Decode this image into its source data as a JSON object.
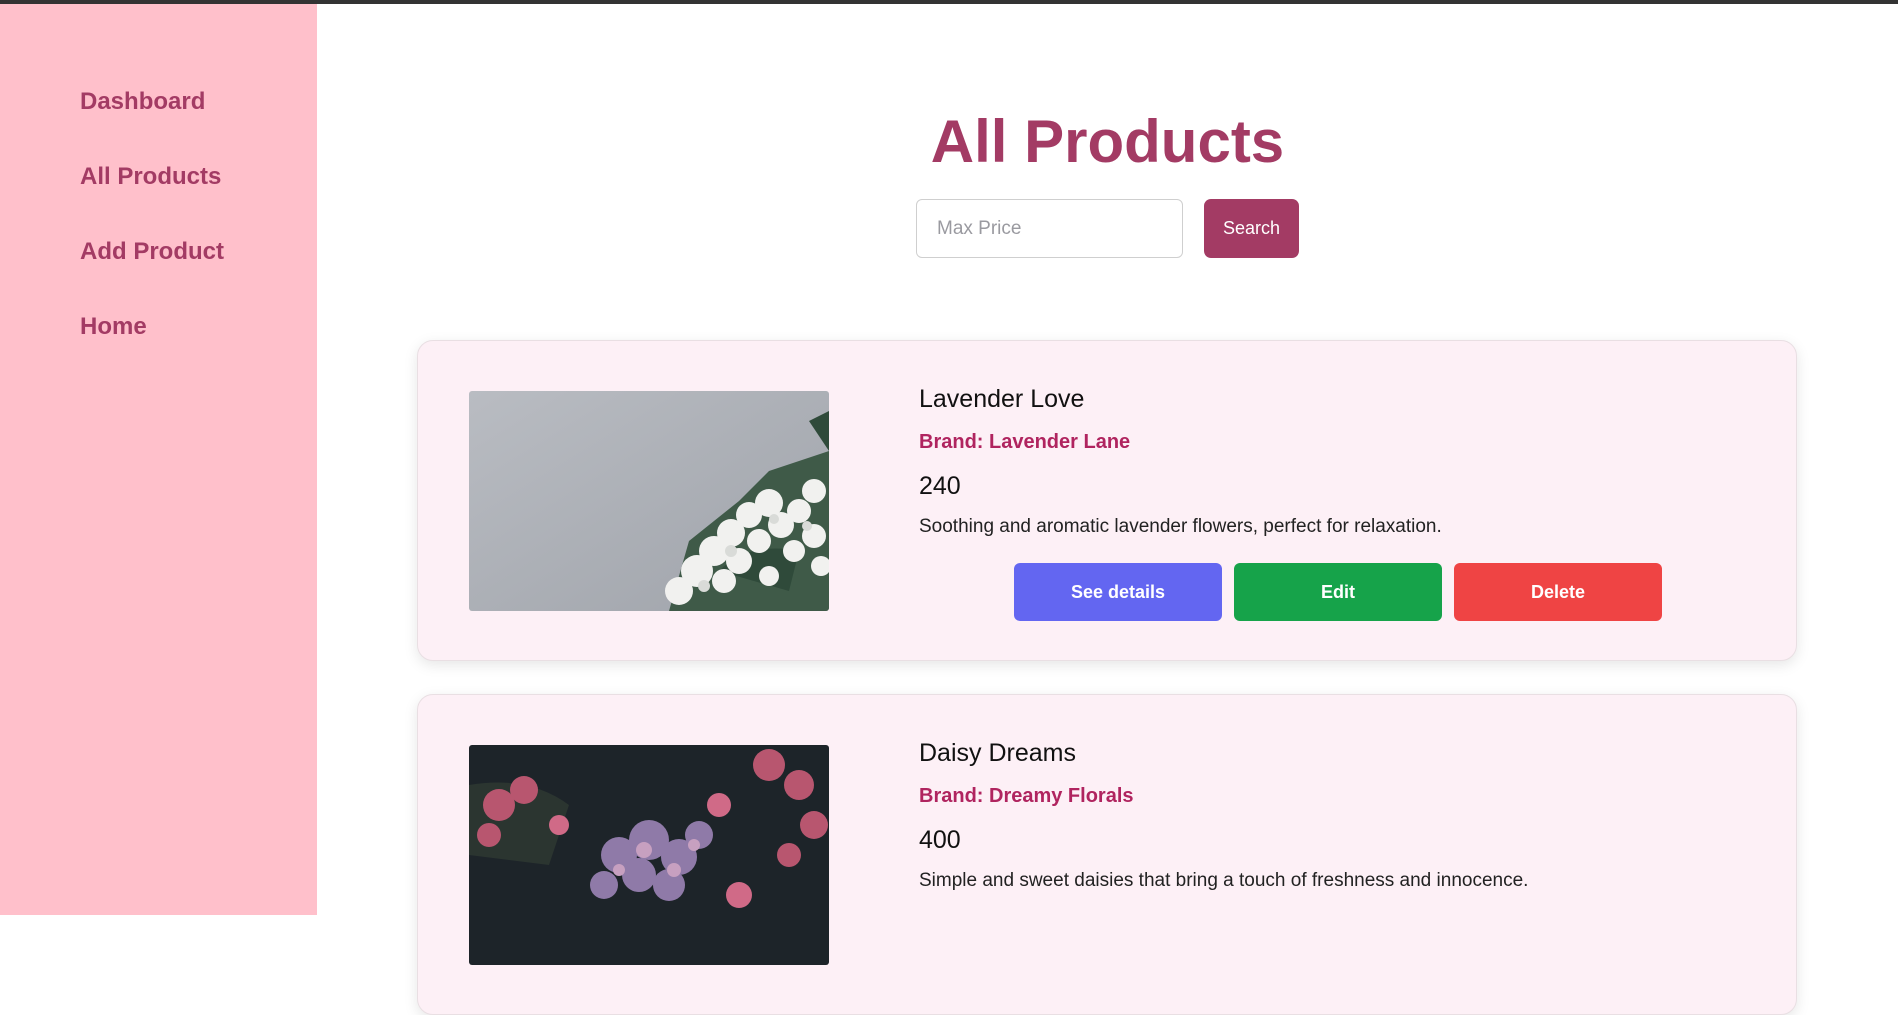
{
  "sidebar": {
    "items": [
      {
        "label": "Dashboard"
      },
      {
        "label": "All Products"
      },
      {
        "label": "Add Product"
      },
      {
        "label": "Home"
      }
    ]
  },
  "main": {
    "title": "All Products",
    "search": {
      "placeholder": "Max Price",
      "value": "",
      "button_label": "Search"
    },
    "products": [
      {
        "name": "Lavender Love",
        "brand": "Brand: Lavender Lane",
        "price": "240",
        "description": "Soothing and aromatic lavender flowers, perfect for relaxation.",
        "actions": [
          "See details",
          "Edit",
          "Delete"
        ]
      },
      {
        "name": "Daisy Dreams",
        "brand": "Brand: Dreamy Florals",
        "price": "400",
        "description": "Simple and sweet daisies that bring a touch of freshness and innocence."
      }
    ]
  },
  "colors": {
    "sidebar_bg": "#ffc0cb",
    "accent": "#a33b64",
    "brand_text": "#b0245f",
    "card_bg": "#fdf0f6",
    "details_button": "#6366f1",
    "edit_button": "#16a34a",
    "delete_button": "#ef4444"
  }
}
